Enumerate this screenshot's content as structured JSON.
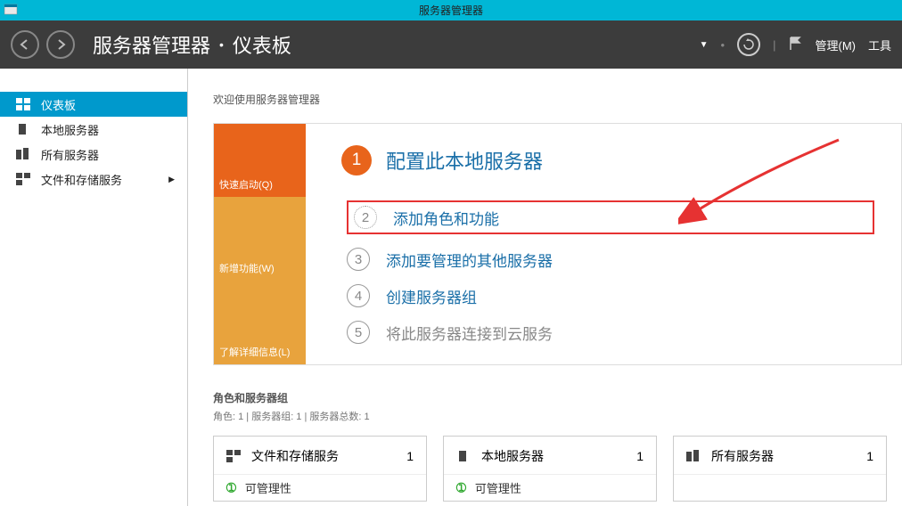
{
  "titlebar": {
    "title": "服务器管理器"
  },
  "breadcrumb": {
    "app": "服务器管理器",
    "sep": "•",
    "page": "仪表板"
  },
  "toolbar": {
    "manage": "管理(M)",
    "tools": "工具"
  },
  "sidebar": {
    "items": [
      {
        "label": "仪表板"
      },
      {
        "label": "本地服务器"
      },
      {
        "label": "所有服务器"
      },
      {
        "label": "文件和存储服务"
      }
    ]
  },
  "welcome": "欢迎使用服务器管理器",
  "tabs": {
    "quickstart": "快速启动(Q)",
    "whatsnew": "新增功能(W)",
    "learnmore": "了解详细信息(L)"
  },
  "hero": {
    "step1": {
      "num": "1",
      "text": "配置此本地服务器"
    },
    "steps": [
      {
        "num": "2",
        "text": "添加角色和功能"
      },
      {
        "num": "3",
        "text": "添加要管理的其他服务器"
      },
      {
        "num": "4",
        "text": "创建服务器组"
      },
      {
        "num": "5",
        "text": "将此服务器连接到云服务"
      }
    ]
  },
  "section2": {
    "title": "角色和服务器组",
    "sub": "角色: 1 | 服务器组: 1 | 服务器总数: 1"
  },
  "tiles": [
    {
      "title": "文件和存储服务",
      "count": "1",
      "row1": "可管理性"
    },
    {
      "title": "本地服务器",
      "count": "1",
      "row1": "可管理性"
    },
    {
      "title": "所有服务器",
      "count": "1",
      "row1": ""
    }
  ]
}
